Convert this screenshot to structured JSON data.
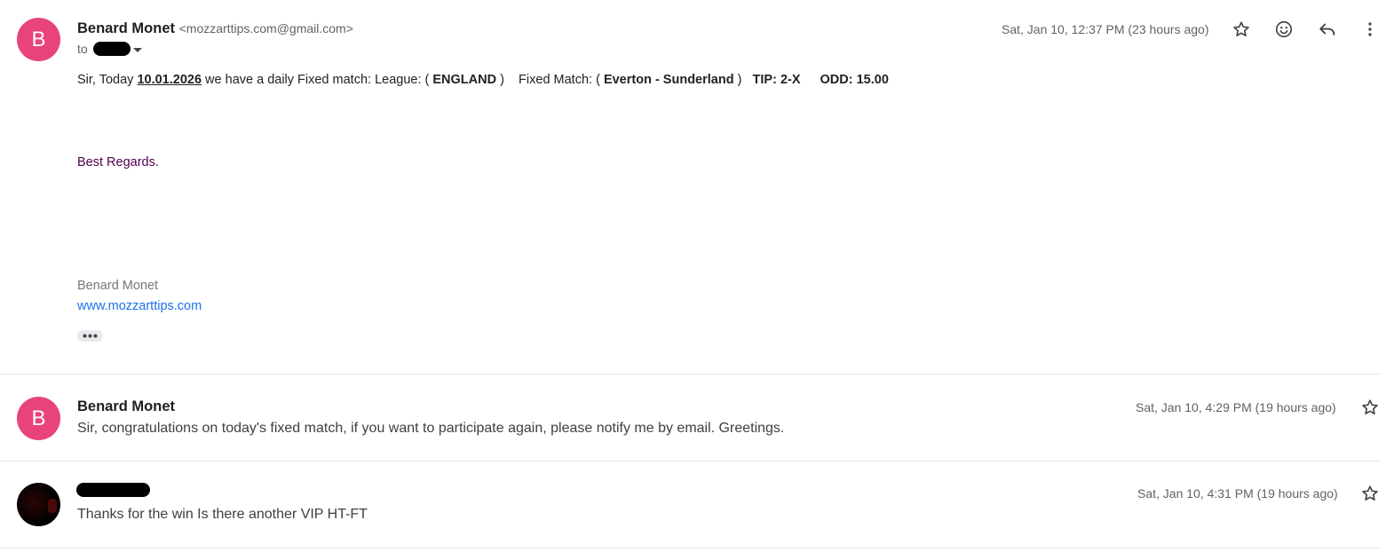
{
  "message1": {
    "avatar_letter": "B",
    "sender_name": "Benard Monet",
    "sender_email": "<mozzarttips.com@gmail.com>",
    "to_label": "to",
    "timestamp": "Sat, Jan 10, 12:37 PM (23 hours ago)",
    "body": {
      "p1": "Sir, Today ",
      "date": "10.01.2026",
      "p2": " we have a daily Fixed match: League: ( ",
      "league": "ENGLAND",
      "p3": " )    Fixed Match: ( ",
      "match": "Everton - Sunderland",
      "p4": " )   ",
      "tip": "TIP: 2-X",
      "odd": "ODD: 15.00"
    },
    "regards": "Best Regards.",
    "signature_name": "Benard Monet",
    "signature_link": "www.mozzarttips.com"
  },
  "message2": {
    "avatar_letter": "B",
    "sender_name": "Benard Monet",
    "timestamp": "Sat, Jan 10, 4:29 PM (19 hours ago)",
    "snippet": "Sir, congratulations on today's fixed match, if you want to participate again, please notify me by email. Greetings."
  },
  "message3": {
    "timestamp": "Sat, Jan 10, 4:31 PM (19 hours ago)",
    "snippet": "Thanks for the win Is there another VIP HT-FT"
  },
  "icons": {
    "star": "star-icon",
    "emoji": "emoji-icon",
    "reply": "reply-icon",
    "more": "more-vert-icon"
  },
  "colors": {
    "avatar_pink": "#e8437c",
    "link_blue": "#1a73e8",
    "regards_purple": "#500050"
  }
}
